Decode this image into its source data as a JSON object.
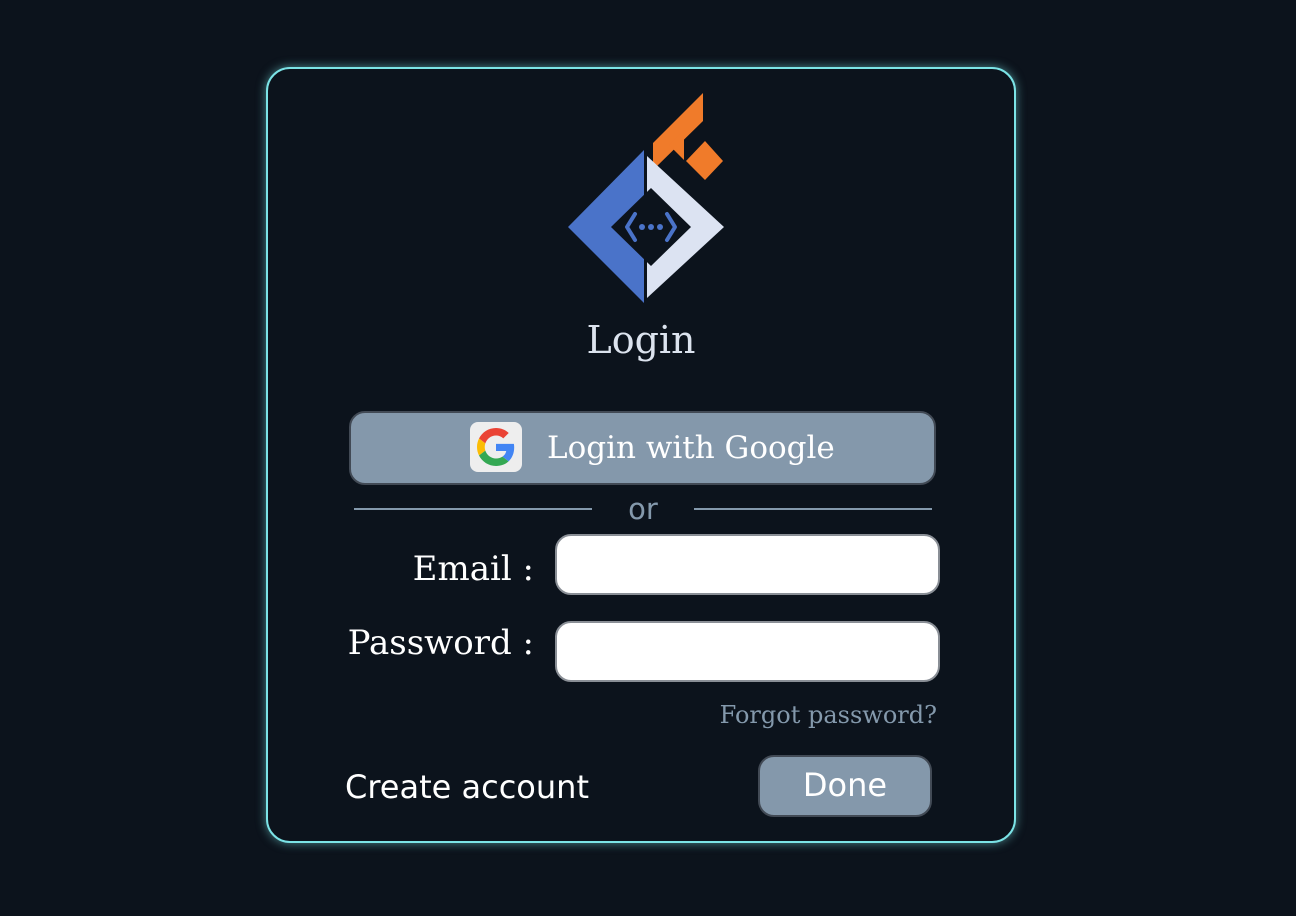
{
  "login": {
    "title": "Login",
    "google_button_label": "Login with Google",
    "separator_text": "or",
    "email_label": "Email :",
    "email_value": "",
    "password_label": "Password :",
    "password_value": "",
    "forgot_password_link": "Forgot password?",
    "create_account_link": "Create account",
    "done_button_label": "Done"
  },
  "icons": {
    "logo": "app-logo-icon",
    "google": "google-icon"
  },
  "colors": {
    "background": "#0c131c",
    "card_border": "#7be3e6",
    "button_fill": "#8498ab",
    "accent_orange": "#f07b2a",
    "logo_blue": "#4a73c9",
    "logo_light": "#dce3f2",
    "muted_text": "#8499ac"
  }
}
